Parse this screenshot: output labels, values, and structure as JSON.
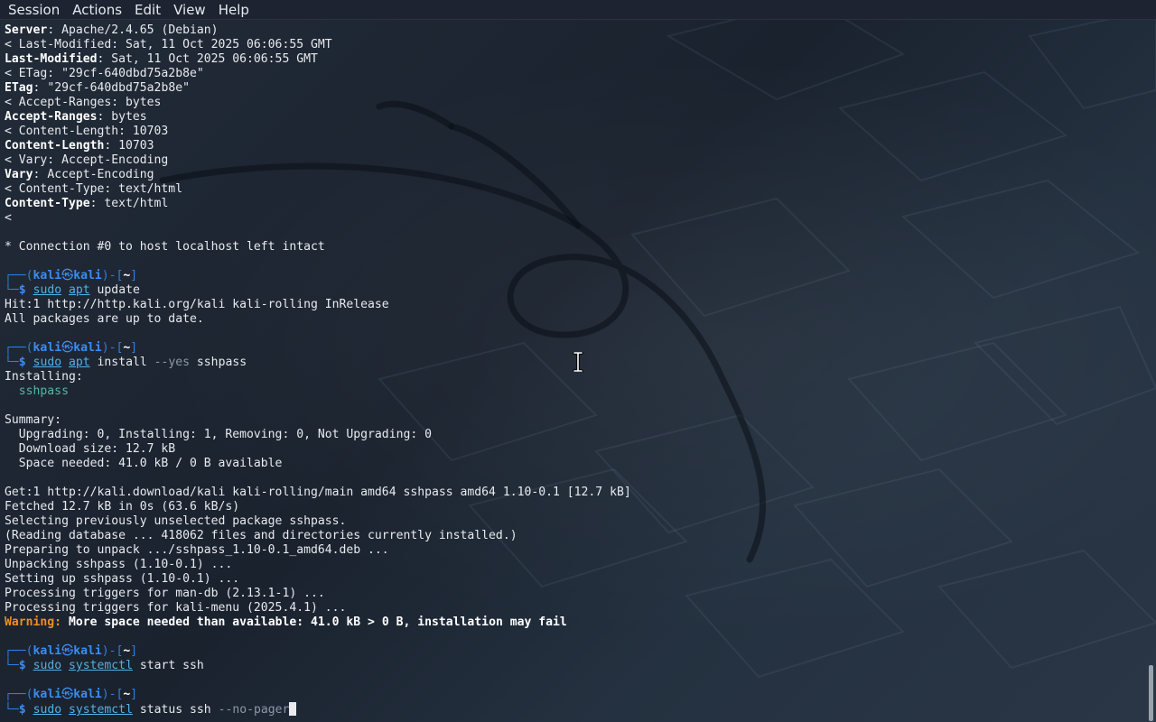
{
  "menubar": {
    "items": [
      "Session",
      "Actions",
      "Edit",
      "View",
      "Help"
    ]
  },
  "prompt": {
    "frame_top": "┌──(",
    "user": "kali",
    "at": "㉿",
    "host": "kali",
    "close": ")-[",
    "dir": "~",
    "dir_close": "]",
    "frame_bottom": "└─",
    "dollar": "$"
  },
  "output": {
    "l01_key": "Server",
    "l01_val": ": Apache/2.4.65 (Debian)",
    "l02": "< Last-Modified: Sat, 11 Oct 2025 06:06:55 GMT",
    "l03_key": "Last-Modified",
    "l03_val": ": Sat, 11 Oct 2025 06:06:55 GMT",
    "l04": "< ETag: \"29cf-640dbd75a2b8e\"",
    "l05_key": "ETag",
    "l05_val": ": \"29cf-640dbd75a2b8e\"",
    "l06": "< Accept-Ranges: bytes",
    "l07_key": "Accept-Ranges",
    "l07_val": ": bytes",
    "l08": "< Content-Length: 10703",
    "l09_key": "Content-Length",
    "l09_val": ": 10703",
    "l10": "< Vary: Accept-Encoding",
    "l11_key": "Vary",
    "l11_val": ": Accept-Encoding",
    "l12": "< Content-Type: text/html",
    "l13_key": "Content-Type",
    "l13_val": ": text/html",
    "l14": "<",
    "l16": "* Connection #0 to host localhost left intact",
    "update_1": "Hit:1 http://http.kali.org/kali kali-rolling InRelease",
    "update_2": "All packages are up to date.",
    "install_1": "Installing:",
    "install_pkg": "  sshpass",
    "summary_1": "Summary:",
    "summary_2": "  Upgrading: 0, Installing: 1, Removing: 0, Not Upgrading: 0",
    "summary_3": "  Download size: 12.7 kB",
    "summary_4": "  Space needed: 41.0 kB / 0 B available",
    "dl_1": "Get:1 http://kali.download/kali kali-rolling/main amd64 sshpass amd64 1.10-0.1 [12.7 kB]",
    "dl_2": "Fetched 12.7 kB in 0s (63.6 kB/s)",
    "dl_3": "Selecting previously unselected package sshpass.",
    "dl_4": "(Reading database ... 418062 files and directories currently installed.)",
    "dl_5": "Preparing to unpack .../sshpass_1.10-0.1_amd64.deb ...",
    "dl_6": "Unpacking sshpass (1.10-0.1) ...",
    "dl_7": "Setting up sshpass (1.10-0.1) ...",
    "dl_8": "Processing triggers for man-db (2.13.1-1) ...",
    "dl_9": "Processing triggers for kali-menu (2025.4.1) ...",
    "warn_label": "Warning:",
    "warn_text": " More space needed than available: 41.0 kB > 0 B, installation may fail"
  },
  "commands": {
    "c1": {
      "sudo": "sudo",
      "tool": "apt",
      "rest": " update"
    },
    "c2": {
      "sudo": "sudo",
      "tool": "apt",
      "rest": " install ",
      "flag": "--yes",
      "arg": " sshpass"
    },
    "c3": {
      "sudo": "sudo",
      "tool": "systemctl",
      "rest": " start ssh"
    },
    "c4": {
      "sudo": "sudo",
      "tool": "systemctl",
      "rest": " status ssh ",
      "flag": "--no-pager"
    }
  },
  "colors": {
    "background": "#1b2330",
    "prompt_blue": "#3b8df0",
    "warning_orange": "#f0901a",
    "package_teal": "#57b6a0"
  },
  "icons": {
    "cursor": "ibeam-cursor-icon",
    "kali_logo": "kali-dragon-logo"
  }
}
